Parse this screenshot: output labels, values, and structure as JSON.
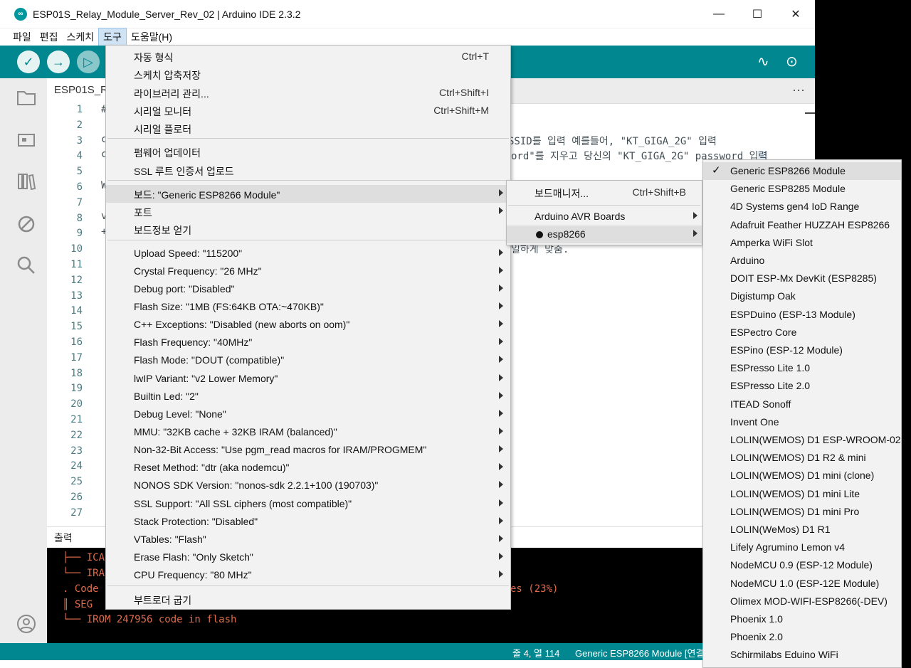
{
  "window": {
    "title": "ESP01S_Relay_Module_Server_Rev_02 | Arduino IDE 2.3.2",
    "app_icon": "arduino-logo-icon",
    "controls": [
      "—",
      "☐",
      "✕"
    ]
  },
  "menubar": {
    "items": [
      "파일",
      "편집",
      "스케치",
      "도구",
      "도움말(H)"
    ],
    "active": "도구"
  },
  "toolbar": {
    "verify": "✓",
    "upload": "→",
    "debug": "▷",
    "plotter": "∿",
    "monitor": "⊙"
  },
  "colors": {
    "accent": "#00878f",
    "output_text": "#e06b4b"
  },
  "editor": {
    "tab_label": "ESP01S_R",
    "tab_more": "···",
    "line_numbers": [
      "1",
      "2",
      "3",
      "4",
      "5",
      "6",
      "7",
      "8",
      "9",
      "10",
      "11",
      "12",
      "13",
      "14",
      "15",
      "16",
      "17",
      "18",
      "19",
      "20",
      "21",
      "22",
      "23",
      "24",
      "25",
      "26",
      "27"
    ],
    "fragments": {
      "l1": "#",
      "l3a": "c",
      "l3b": " SSID를 입력 예를들어, \"KT_GIGA_2G\" 입력",
      "l4a": "c",
      "l4b": "ord\"를 지우고 당신의 \"KT_GIGA_2G\" password 입",
      "l4hl": "력",
      "l6": "W",
      "l8": "v",
      "l9": "+",
      "l10": "일하게 맞춤."
    }
  },
  "output": {
    "label": "출력",
    "lines": [
      "├── ICA",
      "└── IRA",
      ". Code",
      "║    SEG",
      "└── IROM     247956   code in flash"
    ],
    "right_fragment": "es (23%)"
  },
  "statusbar": {
    "position": "줄 4, 열 114",
    "board": "Generic ESP8266 Module [연결"
  },
  "tools_menu": {
    "items": [
      {
        "label": "자동 형식",
        "shortcut": "Ctrl+T"
      },
      {
        "label": "스케치 압축저장",
        "shortcut": ""
      },
      {
        "label": "라이브러리 관리...",
        "shortcut": "Ctrl+Shift+I"
      },
      {
        "label": "시리얼 모니터",
        "shortcut": "Ctrl+Shift+M"
      },
      {
        "label": "시리얼 플로터",
        "shortcut": ""
      },
      {
        "label": "펌웨어 업데이터",
        "shortcut": ""
      },
      {
        "label": "SSL 루트 인증서 업로드",
        "shortcut": ""
      },
      {
        "label": "보드: \"Generic ESP8266 Module\"",
        "shortcut": ""
      },
      {
        "label": "포트",
        "shortcut": ""
      },
      {
        "label": "보드정보 얻기",
        "shortcut": ""
      },
      {
        "label": "Upload Speed: \"115200\"",
        "shortcut": ""
      },
      {
        "label": "Crystal Frequency: \"26 MHz\"",
        "shortcut": ""
      },
      {
        "label": "Debug port: \"Disabled\"",
        "shortcut": ""
      },
      {
        "label": "Flash Size: \"1MB (FS:64KB OTA:~470KB)\"",
        "shortcut": ""
      },
      {
        "label": "C++ Exceptions: \"Disabled (new aborts on oom)\"",
        "shortcut": ""
      },
      {
        "label": "Flash Frequency: \"40MHz\"",
        "shortcut": ""
      },
      {
        "label": "Flash Mode: \"DOUT (compatible)\"",
        "shortcut": ""
      },
      {
        "label": "lwIP Variant: \"v2 Lower Memory\"",
        "shortcut": ""
      },
      {
        "label": "Builtin Led: \"2\"",
        "shortcut": ""
      },
      {
        "label": "Debug Level: \"None\"",
        "shortcut": ""
      },
      {
        "label": "MMU: \"32KB cache + 32KB IRAM (balanced)\"",
        "shortcut": ""
      },
      {
        "label": "Non-32-Bit Access: \"Use pgm_read macros for IRAM/PROGMEM\"",
        "shortcut": ""
      },
      {
        "label": "Reset Method: \"dtr (aka nodemcu)\"",
        "shortcut": ""
      },
      {
        "label": "NONOS SDK Version: \"nonos-sdk 2.2.1+100 (190703)\"",
        "shortcut": ""
      },
      {
        "label": "SSL Support: \"All SSL ciphers (most compatible)\"",
        "shortcut": ""
      },
      {
        "label": "Stack Protection: \"Disabled\"",
        "shortcut": ""
      },
      {
        "label": "VTables: \"Flash\"",
        "shortcut": ""
      },
      {
        "label": "Erase Flash: \"Only Sketch\"",
        "shortcut": ""
      },
      {
        "label": "CPU Frequency: \"80 MHz\"",
        "shortcut": ""
      },
      {
        "label": "부트로더 굽기",
        "shortcut": ""
      }
    ]
  },
  "board_submenu": {
    "items": [
      {
        "label": "보드매니저...",
        "shortcut": "Ctrl+Shift+B"
      },
      {
        "label": "Arduino AVR Boards",
        "shortcut": ""
      },
      {
        "label": "esp8266",
        "shortcut": ""
      }
    ]
  },
  "esp8266_boards": {
    "selected": "Generic ESP8266 Module",
    "items": [
      "Generic ESP8266 Module",
      "Generic ESP8285 Module",
      "4D Systems gen4 IoD Range",
      "Adafruit Feather HUZZAH ESP8266",
      "Amperka WiFi Slot",
      "Arduino",
      "DOIT ESP-Mx DevKit (ESP8285)",
      "Digistump Oak",
      "ESPDuino (ESP-13 Module)",
      "ESPectro Core",
      "ESPino (ESP-12 Module)",
      "ESPresso Lite 1.0",
      "ESPresso Lite 2.0",
      "ITEAD Sonoff",
      "Invent One",
      "LOLIN(WEMOS) D1 ESP-WROOM-02",
      "LOLIN(WEMOS) D1 R2 & mini",
      "LOLIN(WEMOS) D1 mini (clone)",
      "LOLIN(WEMOS) D1 mini Lite",
      "LOLIN(WEMOS) D1 mini Pro",
      "LOLIN(WeMos) D1 R1",
      "Lifely Agrumino Lemon v4",
      "NodeMCU 0.9 (ESP-12 Module)",
      "NodeMCU 1.0 (ESP-12E Module)",
      "Olimex MOD-WIFI-ESP8266(-DEV)",
      "Phoenix 1.0",
      "Phoenix 2.0",
      "Schirmilabs Eduino WiFi"
    ]
  }
}
